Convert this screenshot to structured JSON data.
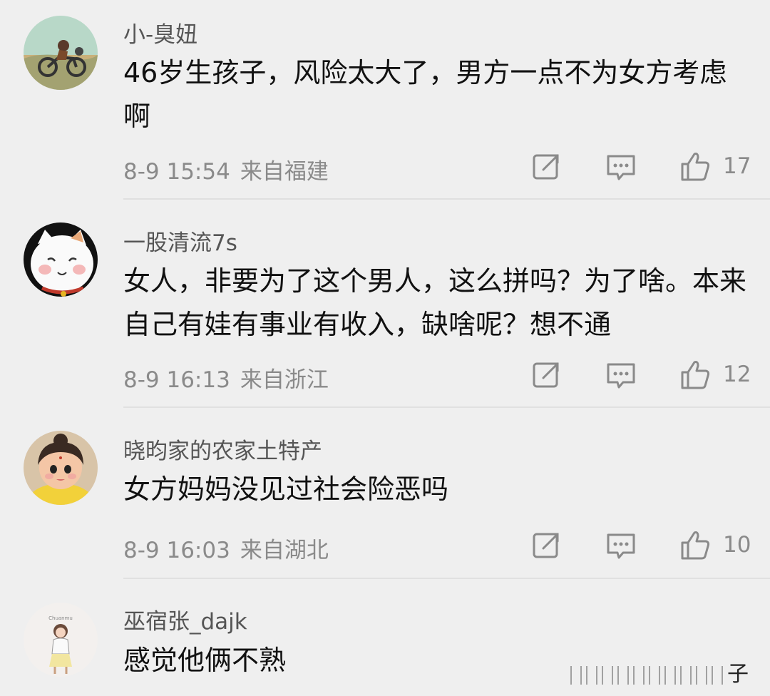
{
  "comments": [
    {
      "username": "小-臭妞",
      "text": "46岁生孩子，风险太大了，男方一点不为女方考虑啊",
      "time": "8-9 15:54",
      "location": "来自福建",
      "likes": "17",
      "avatar_icon": "motorcycle-rider-avatar"
    },
    {
      "username": "一股清流7s",
      "text": "女人，非要为了这个男人，这么拼吗？为了啥。本来自己有娃有事业有收入，缺啥呢？想不通",
      "time": "8-9 16:13",
      "location": "来自浙江",
      "likes": "12",
      "avatar_icon": "lucky-cat-avatar"
    },
    {
      "username": "晓昀家的农家土特产",
      "text": "女方妈妈没见过社会险恶吗",
      "time": "8-9 16:03",
      "location": "来自湖北",
      "likes": "10",
      "avatar_icon": "cartoon-girl-avatar"
    },
    {
      "username": "巫宿张_dajk",
      "text": "感觉他俩不熟",
      "avatar_icon": "sketch-girl-avatar"
    }
  ],
  "watermark": {
    "text": "子"
  },
  "colors": {
    "background": "#efefef",
    "username": "#555555",
    "text": "#111111",
    "meta": "#8a8a8a",
    "icon": "#8a8a8a"
  }
}
